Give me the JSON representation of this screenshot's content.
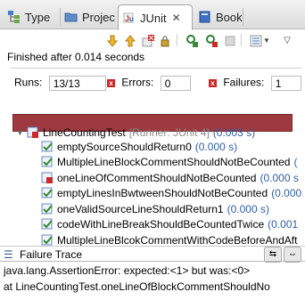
{
  "tabs": [
    {
      "label": "Type"
    },
    {
      "label": "Projec"
    },
    {
      "label": "JUnit"
    },
    {
      "label": "Book"
    }
  ],
  "status": "Finished after 0.014 seconds",
  "counters": {
    "runs_label": "Runs:",
    "runs_value": "13/13",
    "errors_label": "Errors:",
    "errors_value": "0",
    "failures_label": "Failures:",
    "failures_value": "1"
  },
  "progress": {
    "fraction": 1.0,
    "color": "#9e3a3f"
  },
  "tree": {
    "root": {
      "name": "LineCountingTest",
      "runner": "[Runner: JUnit 4]",
      "time": "(0.003 s)"
    },
    "items": [
      {
        "name": "emptySourceShouldReturn0",
        "time": "(0.000 s)"
      },
      {
        "name": "MultipleLineBlockCommentShouldNotBeCounted",
        "time": "("
      },
      {
        "name": "oneLineOfCommentShouldNotBeCounted",
        "time": "(0.000 s"
      },
      {
        "name": "emptyLinesInBwtweenShouldNotBeCounted",
        "time": "(0.000 s"
      },
      {
        "name": "oneValidSourceLineShouldReturn1",
        "time": "(0.000 s)"
      },
      {
        "name": "codeWithLineBreakShouldBeCountedTwice",
        "time": "(0.001"
      },
      {
        "name": "MultipleLineBlcokCommentWithCodeBeforeAndAft",
        "time": ""
      }
    ]
  },
  "failure_trace": {
    "label": "Failure Trace",
    "lines": [
      "java.lang.AssertionError: expected:<1> but was:<0>",
      "at LineCountingTest.oneLineOfBlockCommentShouldNo"
    ]
  }
}
